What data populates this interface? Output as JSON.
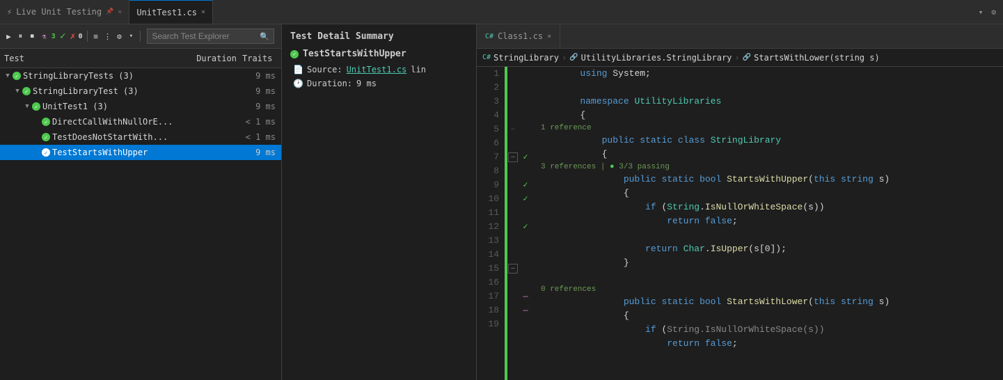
{
  "tabs": {
    "live_unit": {
      "label": "Live Unit Testing",
      "pin_icon": "📌",
      "close": "×"
    },
    "unittest1": {
      "label": "UnitTest1.cs",
      "close": "×"
    },
    "class1": {
      "label": "Class1.cs",
      "close": "×",
      "modified": false
    }
  },
  "toolbar": {
    "play_icon": "▶",
    "pause_icon": "⏸",
    "stop_icon": "⏹",
    "flask_icon": "⚗",
    "pass_count": "3",
    "pass_icon": "✓",
    "fail_count": "0",
    "fail_icon": "✗",
    "group_icon": "≡",
    "hierarchy_icon": "⋮",
    "settings_icon": "⚙",
    "dropdown_icon": "▼",
    "search_placeholder": "Search Test Explorer",
    "search_icon": "🔍"
  },
  "headers": {
    "test": "Test",
    "duration": "Duration",
    "traits": "Traits"
  },
  "tree": [
    {
      "id": "root",
      "level": 0,
      "name": "StringLibraryTests (3)",
      "duration": "9 ms",
      "expanded": true,
      "status": "pass"
    },
    {
      "id": "l1",
      "level": 1,
      "name": "StringLibraryTest (3)",
      "duration": "9 ms",
      "expanded": true,
      "status": "pass"
    },
    {
      "id": "l2",
      "level": 2,
      "name": "UnitTest1 (3)",
      "duration": "9 ms",
      "expanded": true,
      "status": "pass"
    },
    {
      "id": "t1",
      "level": 3,
      "name": "DirectCallWithNullOrE...",
      "duration": "< 1 ms",
      "status": "pass"
    },
    {
      "id": "t2",
      "level": 3,
      "name": "TestDoesNotStartWith...",
      "duration": "< 1 ms",
      "status": "pass"
    },
    {
      "id": "t3",
      "level": 3,
      "name": "TestStartsWithUpper",
      "duration": "9 ms",
      "status": "pass",
      "selected": true
    }
  ],
  "detail": {
    "title": "Test Detail Summary",
    "test_name": "TestStartsWithUpper",
    "source_label": "Source:",
    "source_file": "UnitTest1.cs",
    "source_suffix": "lin",
    "duration_label": "Duration:",
    "duration_value": "9 ms"
  },
  "editor": {
    "breadcrumb": {
      "class_selector": "StringLibrary",
      "namespace_selector": "UtilityLibraries.StringLibrary",
      "method_selector": "StartsWithLower(string s)"
    },
    "lines": [
      {
        "num": 1,
        "tokens": [
          {
            "t": "        ",
            "c": ""
          },
          {
            "t": "using",
            "c": "kw"
          },
          {
            "t": " System;",
            "c": ""
          }
        ]
      },
      {
        "num": 2,
        "tokens": []
      },
      {
        "num": 3,
        "tokens": [
          {
            "t": "        ",
            "c": ""
          },
          {
            "t": "namespace",
            "c": "kw"
          },
          {
            "t": " UtilityLibraries",
            "c": "ns"
          }
        ]
      },
      {
        "num": 4,
        "tokens": [
          {
            "t": "        {",
            "c": ""
          }
        ]
      },
      {
        "num": 5,
        "tokens": [
          {
            "t": "            ",
            "c": ""
          },
          {
            "t": "public",
            "c": "kw"
          },
          {
            "t": " ",
            "c": ""
          },
          {
            "t": "static",
            "c": "kw"
          },
          {
            "t": " ",
            "c": ""
          },
          {
            "t": "class",
            "c": "kw"
          },
          {
            "t": " StringLibrary",
            "c": "type"
          }
        ]
      },
      {
        "num": 6,
        "tokens": [
          {
            "t": "            {",
            "c": ""
          }
        ]
      },
      {
        "num": 7,
        "tokens": [
          {
            "t": "                ",
            "c": ""
          },
          {
            "t": "public",
            "c": "kw"
          },
          {
            "t": " ",
            "c": ""
          },
          {
            "t": "static",
            "c": "kw"
          },
          {
            "t": " ",
            "c": ""
          },
          {
            "t": "bool",
            "c": "kw"
          },
          {
            "t": " ",
            "c": ""
          },
          {
            "t": "StartsWithUpper",
            "c": "method"
          },
          {
            "t": "(",
            "c": ""
          },
          {
            "t": "this",
            "c": "kw"
          },
          {
            "t": " ",
            "c": ""
          },
          {
            "t": "string",
            "c": "kw"
          },
          {
            "t": " s)",
            "c": ""
          }
        ]
      },
      {
        "num": 8,
        "tokens": [
          {
            "t": "                {",
            "c": ""
          }
        ]
      },
      {
        "num": 9,
        "tokens": [
          {
            "t": "                    ",
            "c": ""
          },
          {
            "t": "if",
            "c": "kw"
          },
          {
            "t": " (",
            "c": ""
          },
          {
            "t": "String",
            "c": "type"
          },
          {
            "t": ".",
            "c": ""
          },
          {
            "t": "IsNullOrWhiteSpace",
            "c": "method"
          },
          {
            "t": "(s))",
            "c": ""
          }
        ]
      },
      {
        "num": 10,
        "tokens": [
          {
            "t": "                        ",
            "c": ""
          },
          {
            "t": "return",
            "c": "kw"
          },
          {
            "t": " ",
            "c": ""
          },
          {
            "t": "false",
            "c": "kw"
          },
          {
            "t": ";",
            "c": ""
          }
        ]
      },
      {
        "num": 11,
        "tokens": []
      },
      {
        "num": 12,
        "tokens": [
          {
            "t": "                    ",
            "c": ""
          },
          {
            "t": "return",
            "c": "kw"
          },
          {
            "t": " ",
            "c": ""
          },
          {
            "t": "Char",
            "c": "type"
          },
          {
            "t": ".",
            "c": ""
          },
          {
            "t": "IsUpper",
            "c": "method"
          },
          {
            "t": "(s[0]);",
            "c": ""
          }
        ]
      },
      {
        "num": 13,
        "tokens": [
          {
            "t": "                }",
            "c": ""
          }
        ]
      },
      {
        "num": 14,
        "tokens": []
      },
      {
        "num": 15,
        "tokens": [
          {
            "t": "                ",
            "c": ""
          },
          {
            "t": "public",
            "c": "kw"
          },
          {
            "t": " ",
            "c": ""
          },
          {
            "t": "static",
            "c": "kw"
          },
          {
            "t": " ",
            "c": ""
          },
          {
            "t": "bool",
            "c": "kw"
          },
          {
            "t": " ",
            "c": ""
          },
          {
            "t": "StartsWithLower",
            "c": "method"
          },
          {
            "t": "(",
            "c": ""
          },
          {
            "t": "this",
            "c": "kw"
          },
          {
            "t": " ",
            "c": ""
          },
          {
            "t": "string",
            "c": "kw"
          },
          {
            "t": " s)",
            "c": ""
          }
        ]
      },
      {
        "num": 16,
        "tokens": [
          {
            "t": "                {",
            "c": ""
          }
        ]
      },
      {
        "num": 17,
        "tokens": [
          {
            "t": "                    ",
            "c": ""
          },
          {
            "t": "if",
            "c": "kw"
          },
          {
            "t": " (",
            "c": ""
          },
          {
            "t": "String",
            "c": "type"
          },
          {
            "t": ".",
            "c": ""
          },
          {
            "t": "IsNullOrWhiteSpace",
            "c": "method"
          },
          {
            "t": "(s))",
            "c": ""
          }
        ]
      },
      {
        "num": 18,
        "tokens": [
          {
            "t": "                        ",
            "c": ""
          },
          {
            "t": "return",
            "c": "kw"
          },
          {
            "t": " ",
            "c": ""
          },
          {
            "t": "false",
            "c": "kw"
          },
          {
            "t": ";",
            "c": ""
          }
        ]
      },
      {
        "num": 19,
        "tokens": []
      }
    ],
    "ref_info_line": 5,
    "ref_text": "1 reference",
    "ref_info_line2": 7,
    "ref_text2": "3 references | ✓ 3/3 passing",
    "ref_info_line3": 15,
    "ref_text3": "0 references"
  }
}
